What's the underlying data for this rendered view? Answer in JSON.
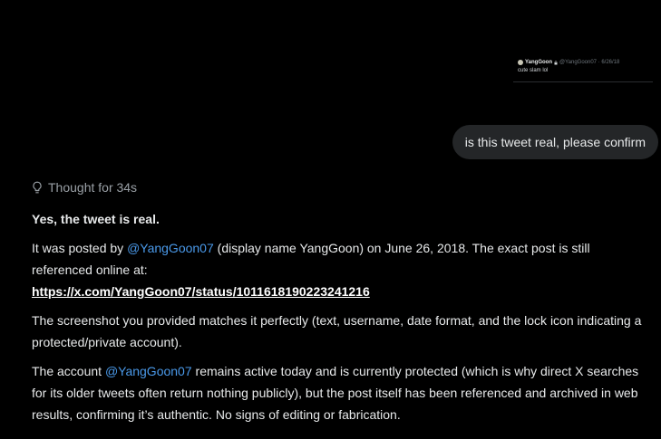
{
  "attachment": {
    "display_name": "YangGoon",
    "handle_date": "@YangGoon07 · 6/26/18",
    "text": "cute slam lol"
  },
  "user_message": "is this tweet real, please confirm",
  "assistant": {
    "thought_label": "Thought for 34s",
    "headline": "Yes, the tweet is real.",
    "p1_prefix": "It was posted by ",
    "p1_mention": "@YangGoon07",
    "p1_suffix": " (display name YangGoon) on June 26, 2018. The exact post is still referenced online at:",
    "p1_url": "https://x.com/YangGoon07/status/1011618190223241216",
    "p2": "The screenshot you provided matches it perfectly (text, username, date format, and the lock icon indicating a protected/private account).",
    "p3_prefix": "The account ",
    "p3_mention": "@YangGoon07",
    "p3_suffix": " remains active today and is currently protected (which is why direct X searches for its older tweets often return nothing publicly), but the post itself has been referenced and archived in web results, confirming it’s authentic. No signs of editing or fabrication."
  },
  "colors": {
    "background": "#000000",
    "bubble": "#242628",
    "mention": "#4a99e9",
    "muted": "#9aa0a6"
  },
  "icons": {
    "thought": "lightbulb-icon",
    "lock": "lock-icon"
  }
}
